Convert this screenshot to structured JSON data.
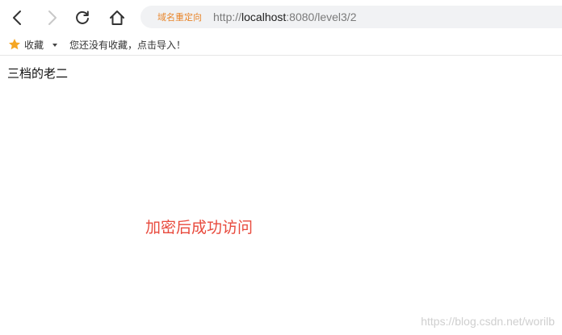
{
  "browser": {
    "toolbar": {
      "back_icon": "back-arrow-icon",
      "forward_icon": "forward-arrow-icon",
      "reload_icon": "reload-icon",
      "home_icon": "home-icon"
    },
    "address_bar": {
      "redirect_label": "域名重定向",
      "url_scheme": "http://",
      "url_host": "localhost",
      "url_rest": ":8080/level3/2"
    },
    "bookmarks_bar": {
      "favorites_label": "收藏",
      "empty_message": "您还没有收藏，点击导入！"
    }
  },
  "page": {
    "heading": "三档的老二",
    "message": "加密后成功访问"
  },
  "watermark": "https://blog.csdn.net/worilb",
  "colors": {
    "message": "#e84a3d",
    "redirect_label": "#e8852a",
    "star": "#f5a623"
  }
}
